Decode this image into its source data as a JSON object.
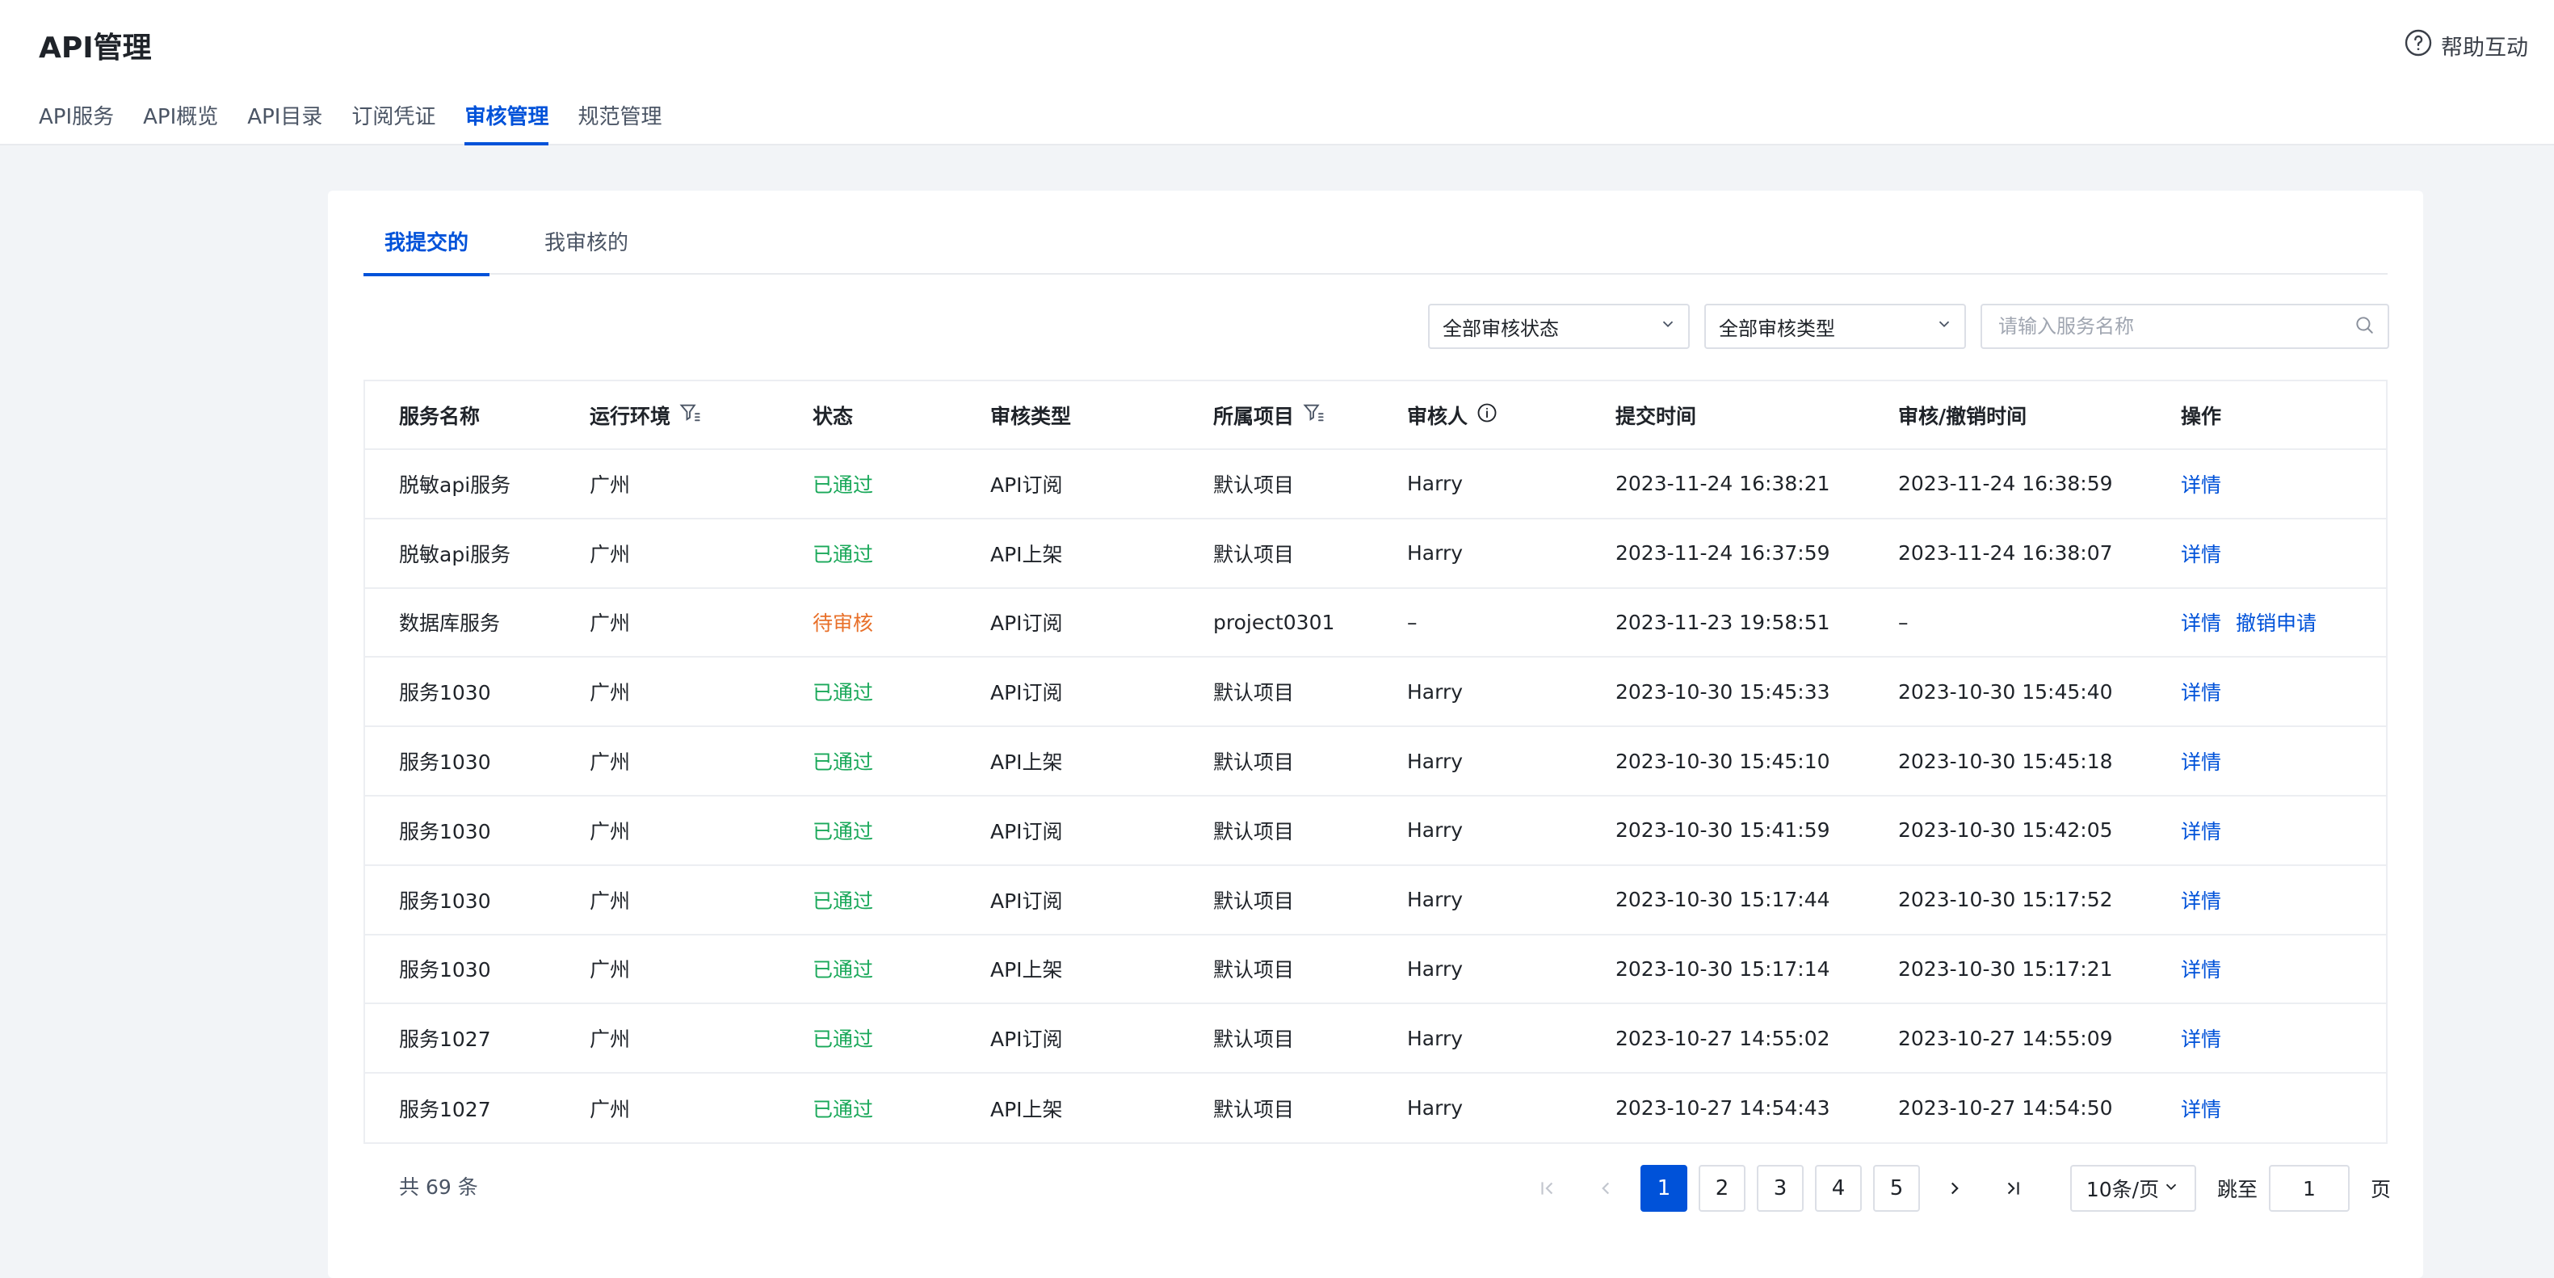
{
  "header": {
    "title": "API管理",
    "help_label": "帮助互动",
    "tabs": [
      {
        "label": "API服务"
      },
      {
        "label": "API概览"
      },
      {
        "label": "API目录"
      },
      {
        "label": "订阅凭证"
      },
      {
        "label": "审核管理",
        "active": true
      },
      {
        "label": "规范管理"
      }
    ]
  },
  "subtabs": [
    {
      "label": "我提交的",
      "active": true
    },
    {
      "label": "我审核的"
    }
  ],
  "filters": {
    "status_select": "全部审核状态",
    "type_select": "全部审核类型",
    "search_placeholder": "请输入服务名称"
  },
  "table": {
    "columns": {
      "name": "服务名称",
      "env": "运行环境",
      "status": "状态",
      "type": "审核类型",
      "project": "所属项目",
      "reviewer": "审核人",
      "submit_time": "提交时间",
      "review_time": "审核/撤销时间",
      "ops": "操作"
    },
    "rows": [
      {
        "name": "脱敏api服务",
        "env": "广州",
        "status": "已通过",
        "type": "API订阅",
        "project": "默认项目",
        "reviewer": "Harry",
        "submit_time": "2023-11-24 16:38:21",
        "review_time": "2023-11-24 16:38:59",
        "ops": [
          "详情"
        ]
      },
      {
        "name": "脱敏api服务",
        "env": "广州",
        "status": "已通过",
        "type": "API上架",
        "project": "默认项目",
        "reviewer": "Harry",
        "submit_time": "2023-11-24 16:37:59",
        "review_time": "2023-11-24 16:38:07",
        "ops": [
          "详情"
        ]
      },
      {
        "name": "数据库服务",
        "env": "广州",
        "status": "待审核",
        "type": "API订阅",
        "project": "project0301",
        "reviewer": "–",
        "submit_time": "2023-11-23 19:58:51",
        "review_time": "–",
        "ops": [
          "详情",
          "撤销申请"
        ]
      },
      {
        "name": "服务1030",
        "env": "广州",
        "status": "已通过",
        "type": "API订阅",
        "project": "默认项目",
        "reviewer": "Harry",
        "submit_time": "2023-10-30 15:45:33",
        "review_time": "2023-10-30 15:45:40",
        "ops": [
          "详情"
        ]
      },
      {
        "name": "服务1030",
        "env": "广州",
        "status": "已通过",
        "type": "API上架",
        "project": "默认项目",
        "reviewer": "Harry",
        "submit_time": "2023-10-30 15:45:10",
        "review_time": "2023-10-30 15:45:18",
        "ops": [
          "详情"
        ]
      },
      {
        "name": "服务1030",
        "env": "广州",
        "status": "已通过",
        "type": "API订阅",
        "project": "默认项目",
        "reviewer": "Harry",
        "submit_time": "2023-10-30 15:41:59",
        "review_time": "2023-10-30 15:42:05",
        "ops": [
          "详情"
        ]
      },
      {
        "name": "服务1030",
        "env": "广州",
        "status": "已通过",
        "type": "API订阅",
        "project": "默认项目",
        "reviewer": "Harry",
        "submit_time": "2023-10-30 15:17:44",
        "review_time": "2023-10-30 15:17:52",
        "ops": [
          "详情"
        ]
      },
      {
        "name": "服务1030",
        "env": "广州",
        "status": "已通过",
        "type": "API上架",
        "project": "默认项目",
        "reviewer": "Harry",
        "submit_time": "2023-10-30 15:17:14",
        "review_time": "2023-10-30 15:17:21",
        "ops": [
          "详情"
        ]
      },
      {
        "name": "服务1027",
        "env": "广州",
        "status": "已通过",
        "type": "API订阅",
        "project": "默认项目",
        "reviewer": "Harry",
        "submit_time": "2023-10-27 14:55:02",
        "review_time": "2023-10-27 14:55:09",
        "ops": [
          "详情"
        ]
      },
      {
        "name": "服务1027",
        "env": "广州",
        "status": "已通过",
        "type": "API上架",
        "project": "默认项目",
        "reviewer": "Harry",
        "submit_time": "2023-10-27 14:54:43",
        "review_time": "2023-10-27 14:54:50",
        "ops": [
          "详情"
        ]
      }
    ]
  },
  "pagination": {
    "total_text": "共 69 条",
    "pages": [
      "1",
      "2",
      "3",
      "4",
      "5"
    ],
    "current": "1",
    "page_size": "10条/页",
    "jump_label": "跳至",
    "jump_value": "1",
    "page_suffix": "页"
  },
  "colors": {
    "accent": "#0052d9",
    "pass": "#1aa85a",
    "pending": "#e8702a"
  }
}
